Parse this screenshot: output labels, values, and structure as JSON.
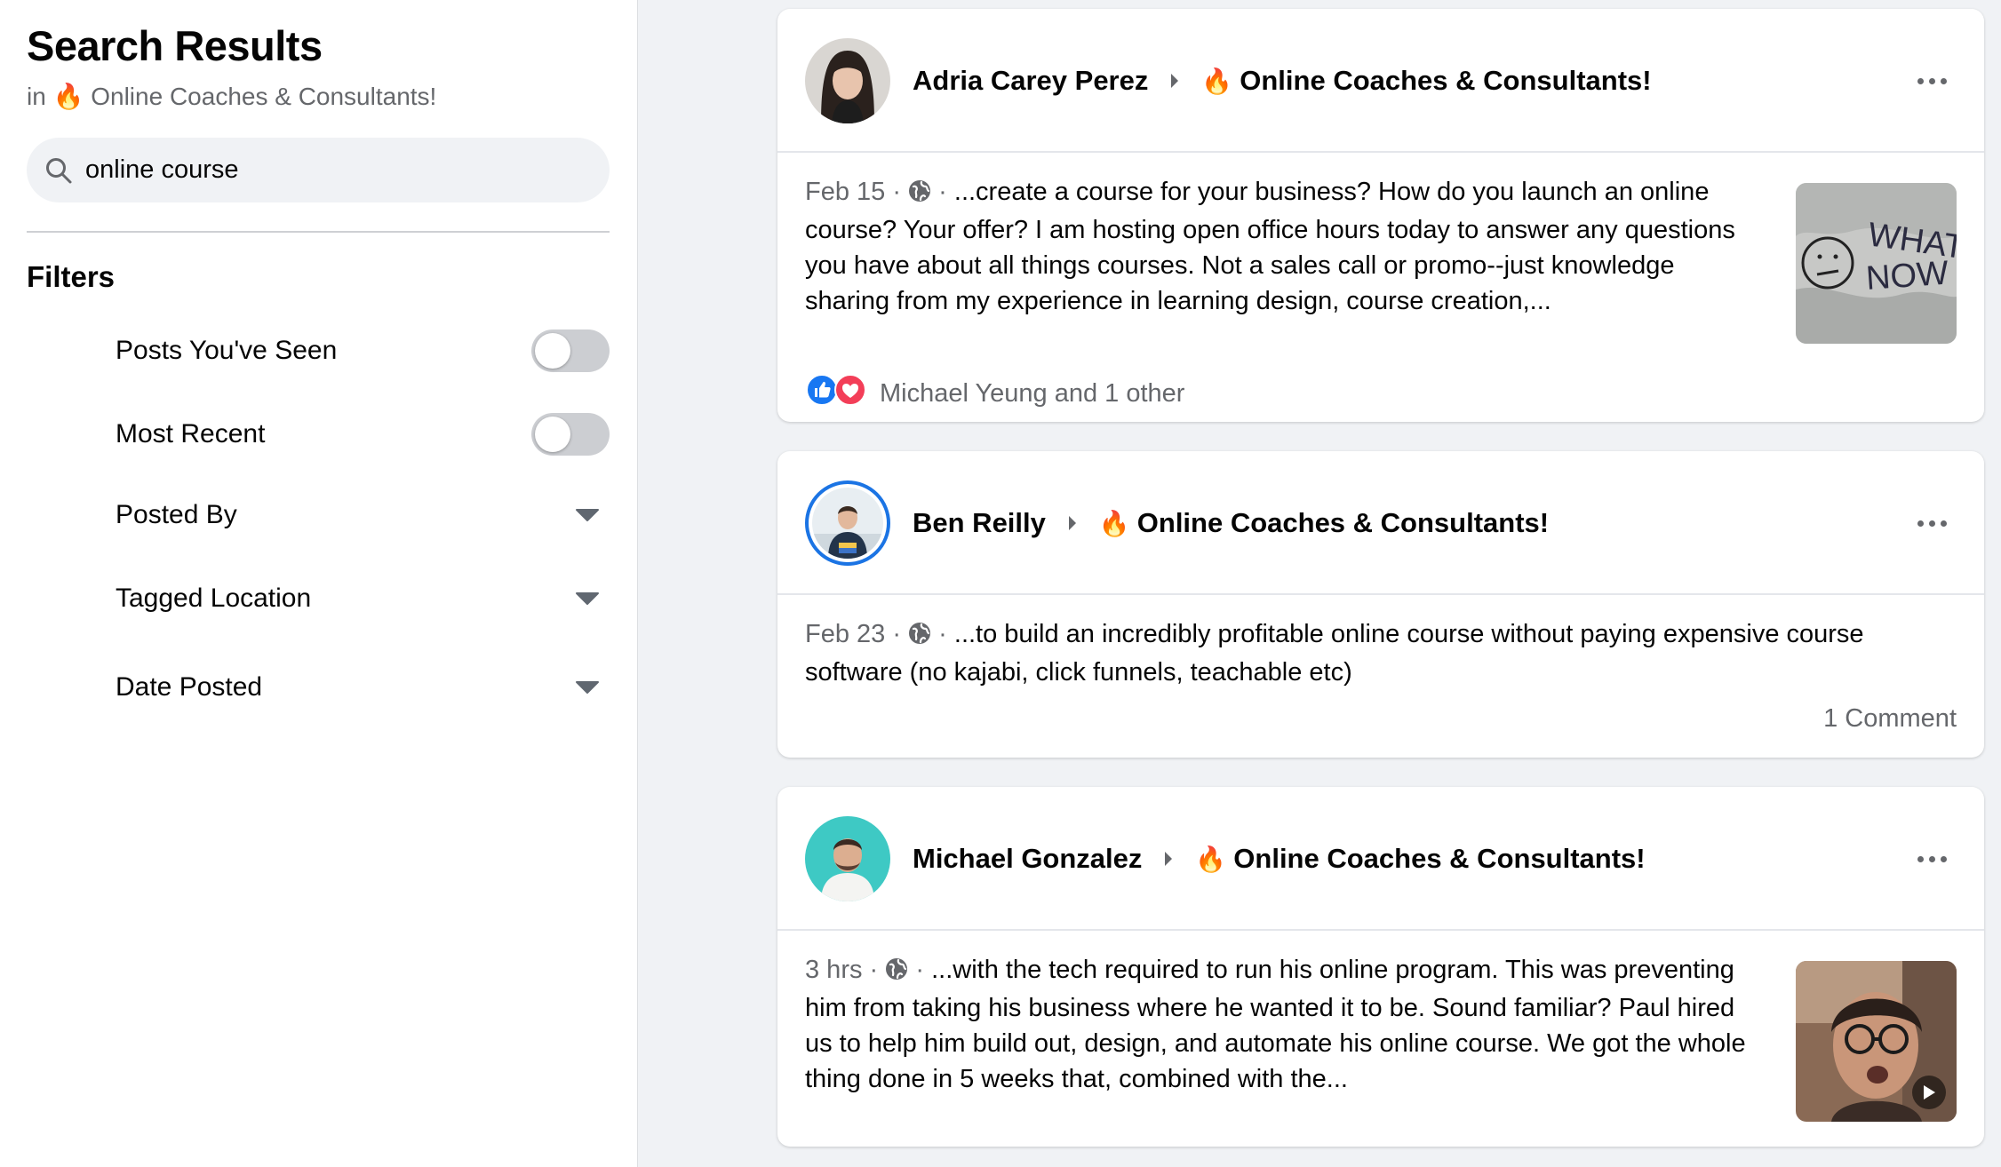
{
  "sidebar": {
    "title": "Search Results",
    "subtitle_prefix": "in",
    "subtitle_emoji": "🔥",
    "group_name": "Online Coaches & Consultants!",
    "search_value": "online course",
    "filters_title": "Filters",
    "filters": [
      {
        "label": "Posts You've Seen",
        "control": "toggle",
        "on": false
      },
      {
        "label": "Most Recent",
        "control": "toggle",
        "on": false
      },
      {
        "label": "Posted By",
        "control": "dropdown"
      },
      {
        "label": "Tagged Location",
        "control": "dropdown"
      },
      {
        "label": "Date Posted",
        "control": "dropdown"
      }
    ]
  },
  "posts": [
    {
      "author": "Adria Carey Perez",
      "group_emoji": "🔥",
      "group": "Online Coaches & Consultants!",
      "date": "Feb 15",
      "dot": "·",
      "text": "...create a course for your business? How do you launch an online course? Your offer? I am hosting open office hours today to answer any questions you have about all things courses. Not a sales call or promo--just knowledge sharing from my experience in learning design, course creation,...",
      "reactions": "Michael Yeung and 1 other",
      "thumb_text": "WHAT NOW"
    },
    {
      "author": "Ben Reilly",
      "group_emoji": "🔥",
      "group": "Online Coaches & Consultants!",
      "date": "Feb 23",
      "dot": "·",
      "text": "...to build an incredibly profitable online course without paying expensive course software (no kajabi, click funnels, teachable etc)",
      "comments": "1 Comment"
    },
    {
      "author": "Michael Gonzalez",
      "group_emoji": "🔥",
      "group": "Online Coaches & Consultants!",
      "date": "3 hrs",
      "dot": "·",
      "text": "...with the tech required to run his online program. This was preventing him from taking his business where he wanted it to be. Sound familiar? Paul hired us to help him build out, design, and automate his online course. We got the whole thing done in 5 weeks that, combined with the..."
    }
  ],
  "colors": {
    "page_bg": "#f0f2f5",
    "secondary_text": "#65676b",
    "like_blue": "#1877f2",
    "love_red": "#f33e58"
  }
}
